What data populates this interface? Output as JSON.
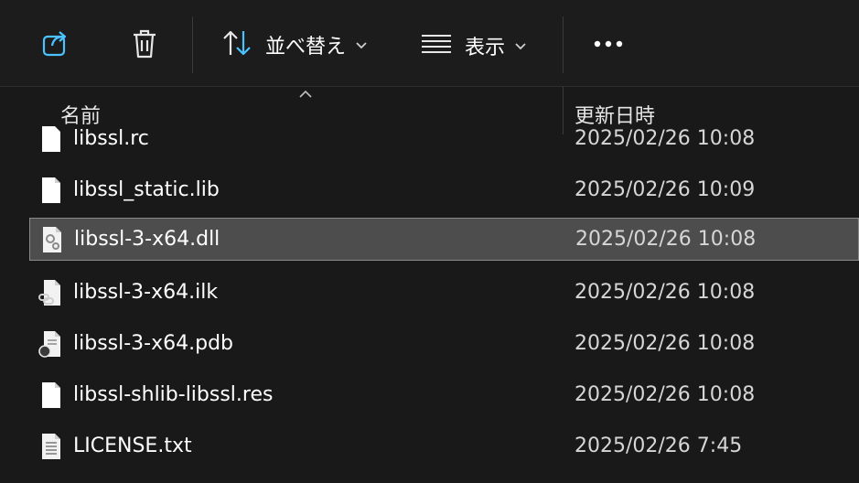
{
  "toolbar": {
    "share_icon": "share-icon",
    "delete_icon": "trash-icon",
    "sort_label": "並べ替え",
    "view_label": "表示",
    "more_icon": "more-icon"
  },
  "columns": {
    "name": "名前",
    "date_modified": "更新日時"
  },
  "files": [
    {
      "name": "libssl.rc",
      "date": "2025/02/26 10:08",
      "icon": "blank-file-icon"
    },
    {
      "name": "libssl_static.lib",
      "date": "2025/02/26 10:09",
      "icon": "blank-file-icon"
    },
    {
      "name": "libssl-3-x64.dll",
      "date": "2025/02/26 10:08",
      "icon": "dll-file-icon",
      "selected": true
    },
    {
      "name": "libssl-3-x64.ilk",
      "date": "2025/02/26 10:08",
      "icon": "linked-file-icon"
    },
    {
      "name": "libssl-3-x64.pdb",
      "date": "2025/02/26 10:08",
      "icon": "pdb-file-icon"
    },
    {
      "name": "libssl-shlib-libssl.res",
      "date": "2025/02/26 10:08",
      "icon": "blank-file-icon"
    },
    {
      "name": "LICENSE.txt",
      "date": "2025/02/26 7:45",
      "icon": "text-file-icon"
    }
  ],
  "colors": {
    "background": "#191919",
    "selected_row": "#4d4d4d",
    "accent": "#4cc2ff"
  }
}
